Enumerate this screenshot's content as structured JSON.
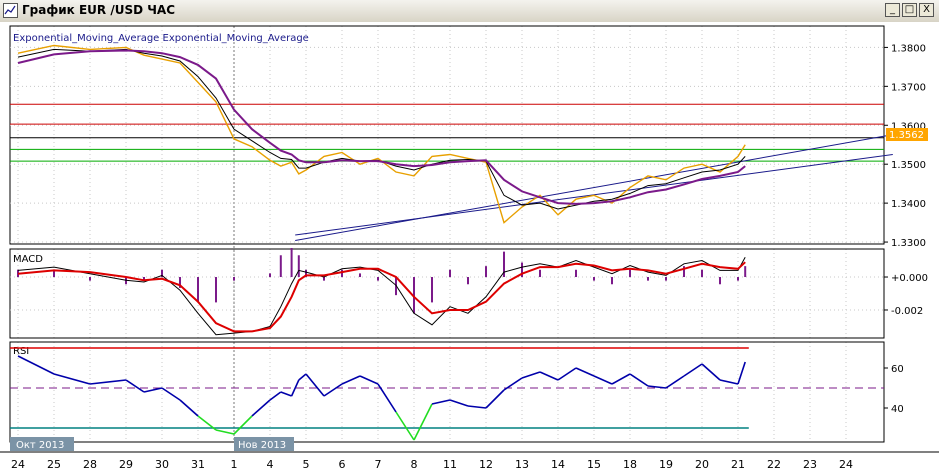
{
  "window": {
    "title": "График EUR /USD ЧАС",
    "buttons": {
      "minimize": "_",
      "maximize": "□",
      "close": "X"
    }
  },
  "colors": {
    "price": "#e8a000",
    "ema_fast": "#000000",
    "ema_slow": "#7b1a8a",
    "resistance": "#cc0000",
    "support": "#00aa00",
    "current_line": "#000000",
    "trendline": "#1a1a8a",
    "macd_main": "#000000",
    "macd_signal": "#dd0000",
    "macd_hist": "#7b1a8a",
    "rsi": "#0000aa",
    "rsi_oversold": "#22dd22",
    "rsi_upper": "#dd0000",
    "rsi_lower": "#008080",
    "rsi_mid": "#7b1a8a",
    "price_tag": "#ffa500",
    "date_tag": "#7b93a6"
  },
  "chart_data": [
    {
      "type": "line",
      "panel": "price",
      "title": "Exponential_Moving_Average Exponential_Moving_Average",
      "ylim": [
        1.3295,
        1.3855
      ],
      "yticks": [
        "1.3800",
        "1.3700",
        "1.3600",
        "1.3500",
        "1.3400",
        "1.3300"
      ],
      "ytick_values": [
        1.38,
        1.37,
        1.36,
        1.35,
        1.34,
        1.33
      ],
      "current_price": "1.3562",
      "current_value": 1.3562,
      "horizontal_levels": {
        "resistance": [
          1.3654,
          1.3603
        ],
        "current": [
          1.3568
        ],
        "support": [
          1.3538,
          1.3508
        ]
      },
      "trendlines": [
        {
          "x": [
            7.7,
            24.3
          ],
          "y": [
            1.3304,
            1.3576
          ]
        },
        {
          "x": [
            7.7,
            24.3
          ],
          "y": [
            1.3318,
            1.3525
          ]
        }
      ],
      "x": [
        0,
        1,
        2,
        3,
        3.5,
        4,
        4.5,
        5,
        5.5,
        6,
        6.5,
        7,
        7.3,
        7.6,
        7.8,
        8,
        8.5,
        9,
        9.5,
        10,
        10.5,
        11,
        11.5,
        12,
        12.5,
        13,
        13.5,
        14,
        14.5,
        15,
        15.5,
        16,
        16.5,
        17,
        17.5,
        18,
        18.5,
        19,
        19.5,
        20,
        20.2
      ],
      "series": [
        {
          "name": "",
          "values": [
            1.3785,
            1.3805,
            1.3795,
            1.38,
            1.378,
            1.377,
            1.376,
            1.371,
            1.366,
            1.3565,
            1.3545,
            1.351,
            1.3495,
            1.3505,
            1.3475,
            1.3485,
            1.352,
            1.353,
            1.35,
            1.3515,
            1.348,
            1.347,
            1.352,
            1.3525,
            1.3515,
            1.3505,
            1.335,
            1.339,
            1.342,
            1.337,
            1.341,
            1.342,
            1.34,
            1.344,
            1.347,
            1.346,
            1.349,
            1.35,
            1.348,
            1.352,
            1.355
          ]
        },
        {
          "name": "",
          "values": [
            1.3775,
            1.3795,
            1.379,
            1.3795,
            1.3785,
            1.3778,
            1.3765,
            1.3725,
            1.367,
            1.359,
            1.356,
            1.353,
            1.3515,
            1.3512,
            1.349,
            1.349,
            1.3505,
            1.3515,
            1.3508,
            1.351,
            1.3495,
            1.3485,
            1.35,
            1.351,
            1.3512,
            1.3508,
            1.342,
            1.3395,
            1.34,
            1.3385,
            1.3395,
            1.3405,
            1.341,
            1.3425,
            1.3445,
            1.345,
            1.3465,
            1.348,
            1.3485,
            1.35,
            1.352
          ]
        },
        {
          "name": "",
          "values": [
            1.376,
            1.3782,
            1.379,
            1.3792,
            1.379,
            1.3785,
            1.3775,
            1.3755,
            1.372,
            1.364,
            1.359,
            1.3555,
            1.3535,
            1.3525,
            1.351,
            1.3505,
            1.3505,
            1.351,
            1.3508,
            1.3508,
            1.35,
            1.3495,
            1.3498,
            1.3505,
            1.3508,
            1.351,
            1.346,
            1.343,
            1.3415,
            1.34,
            1.3398,
            1.34,
            1.3405,
            1.3415,
            1.3428,
            1.3435,
            1.3448,
            1.3462,
            1.347,
            1.348,
            1.3495
          ]
        }
      ]
    },
    {
      "type": "line",
      "panel": "macd",
      "title": "MACD",
      "ylim": [
        -0.0037,
        0.0017
      ],
      "yticks": [
        "+0.000",
        "-0.002"
      ],
      "ytick_values": [
        0.0,
        -0.002
      ],
      "x": [
        0,
        1,
        2,
        3,
        3.5,
        4,
        4.5,
        5,
        5.5,
        6,
        6.5,
        7,
        7.3,
        7.6,
        7.8,
        8,
        8.5,
        9,
        9.5,
        10,
        10.5,
        11,
        11.5,
        12,
        12.5,
        13,
        13.5,
        14,
        14.5,
        15,
        15.5,
        16,
        16.5,
        17,
        17.5,
        18,
        18.5,
        19,
        19.5,
        20,
        20.2
      ],
      "series": [
        {
          "name": "",
          "values": [
            0.0004,
            0.0006,
            0.0002,
            -0.0002,
            -0.0003,
            0.0001,
            -0.0008,
            -0.0022,
            -0.0035,
            -0.0034,
            -0.0033,
            -0.003,
            -0.0018,
            -0.0004,
            0.0004,
            0.0003,
            0.0,
            0.0005,
            0.0006,
            0.0004,
            -0.0005,
            -0.0022,
            -0.0029,
            -0.0018,
            -0.0022,
            -0.0012,
            0.0003,
            0.0006,
            0.0008,
            0.0006,
            0.001,
            0.0006,
            0.0002,
            0.0007,
            0.0003,
            0.0001,
            0.0008,
            0.001,
            0.0004,
            0.0004,
            0.0012
          ]
        },
        {
          "name": "",
          "values": [
            0.0002,
            0.0004,
            0.0003,
            0.0,
            -0.0002,
            -0.0001,
            -0.0005,
            -0.0015,
            -0.0028,
            -0.0033,
            -0.0033,
            -0.0031,
            -0.0024,
            -0.0012,
            -0.0002,
            0.0001,
            0.0001,
            0.0003,
            0.0005,
            0.0005,
            0.0,
            -0.0012,
            -0.0022,
            -0.002,
            -0.002,
            -0.0015,
            -0.0004,
            0.0002,
            0.0006,
            0.0006,
            0.0008,
            0.0007,
            0.0004,
            0.0005,
            0.0004,
            0.0002,
            0.0005,
            0.0008,
            0.0006,
            0.0005,
            0.0009
          ]
        }
      ]
    },
    {
      "type": "line",
      "panel": "rsi",
      "title": "RSI",
      "ylim": [
        23,
        73
      ],
      "yticks": [
        "60",
        "40"
      ],
      "ytick_values": [
        60,
        40
      ],
      "levels": {
        "upper": 70,
        "middle": 50,
        "lower": 30
      },
      "x": [
        0,
        1,
        2,
        3,
        3.5,
        4,
        4.5,
        5,
        5.5,
        6,
        6.5,
        7,
        7.3,
        7.6,
        7.8,
        8,
        8.5,
        9,
        9.5,
        10,
        10.5,
        11,
        11.5,
        12,
        12.5,
        13,
        13.5,
        14,
        14.5,
        15,
        15.5,
        16,
        16.5,
        17,
        17.5,
        18,
        18.5,
        19,
        19.5,
        20,
        20.2
      ],
      "series": [
        {
          "name": "",
          "values": [
            66,
            57,
            52,
            54,
            48,
            50,
            44,
            36,
            29,
            27,
            36,
            44,
            48,
            46,
            54,
            57,
            46,
            52,
            56,
            52,
            38,
            24,
            42,
            44,
            41,
            40,
            49,
            55,
            58,
            54,
            60,
            56,
            52,
            57,
            51,
            50,
            56,
            62,
            54,
            52,
            63
          ]
        }
      ]
    }
  ],
  "x_axis": {
    "tick_labels": [
      "24",
      "25",
      "28",
      "29",
      "30",
      "31",
      "1",
      "4",
      "5",
      "6",
      "7",
      "8",
      "11",
      "12",
      "13",
      "14",
      "15",
      "18",
      "19",
      "20",
      "21",
      "22",
      "23",
      "24"
    ],
    "month_labels": [
      "Окт 2013",
      "Нов 2013"
    ]
  }
}
